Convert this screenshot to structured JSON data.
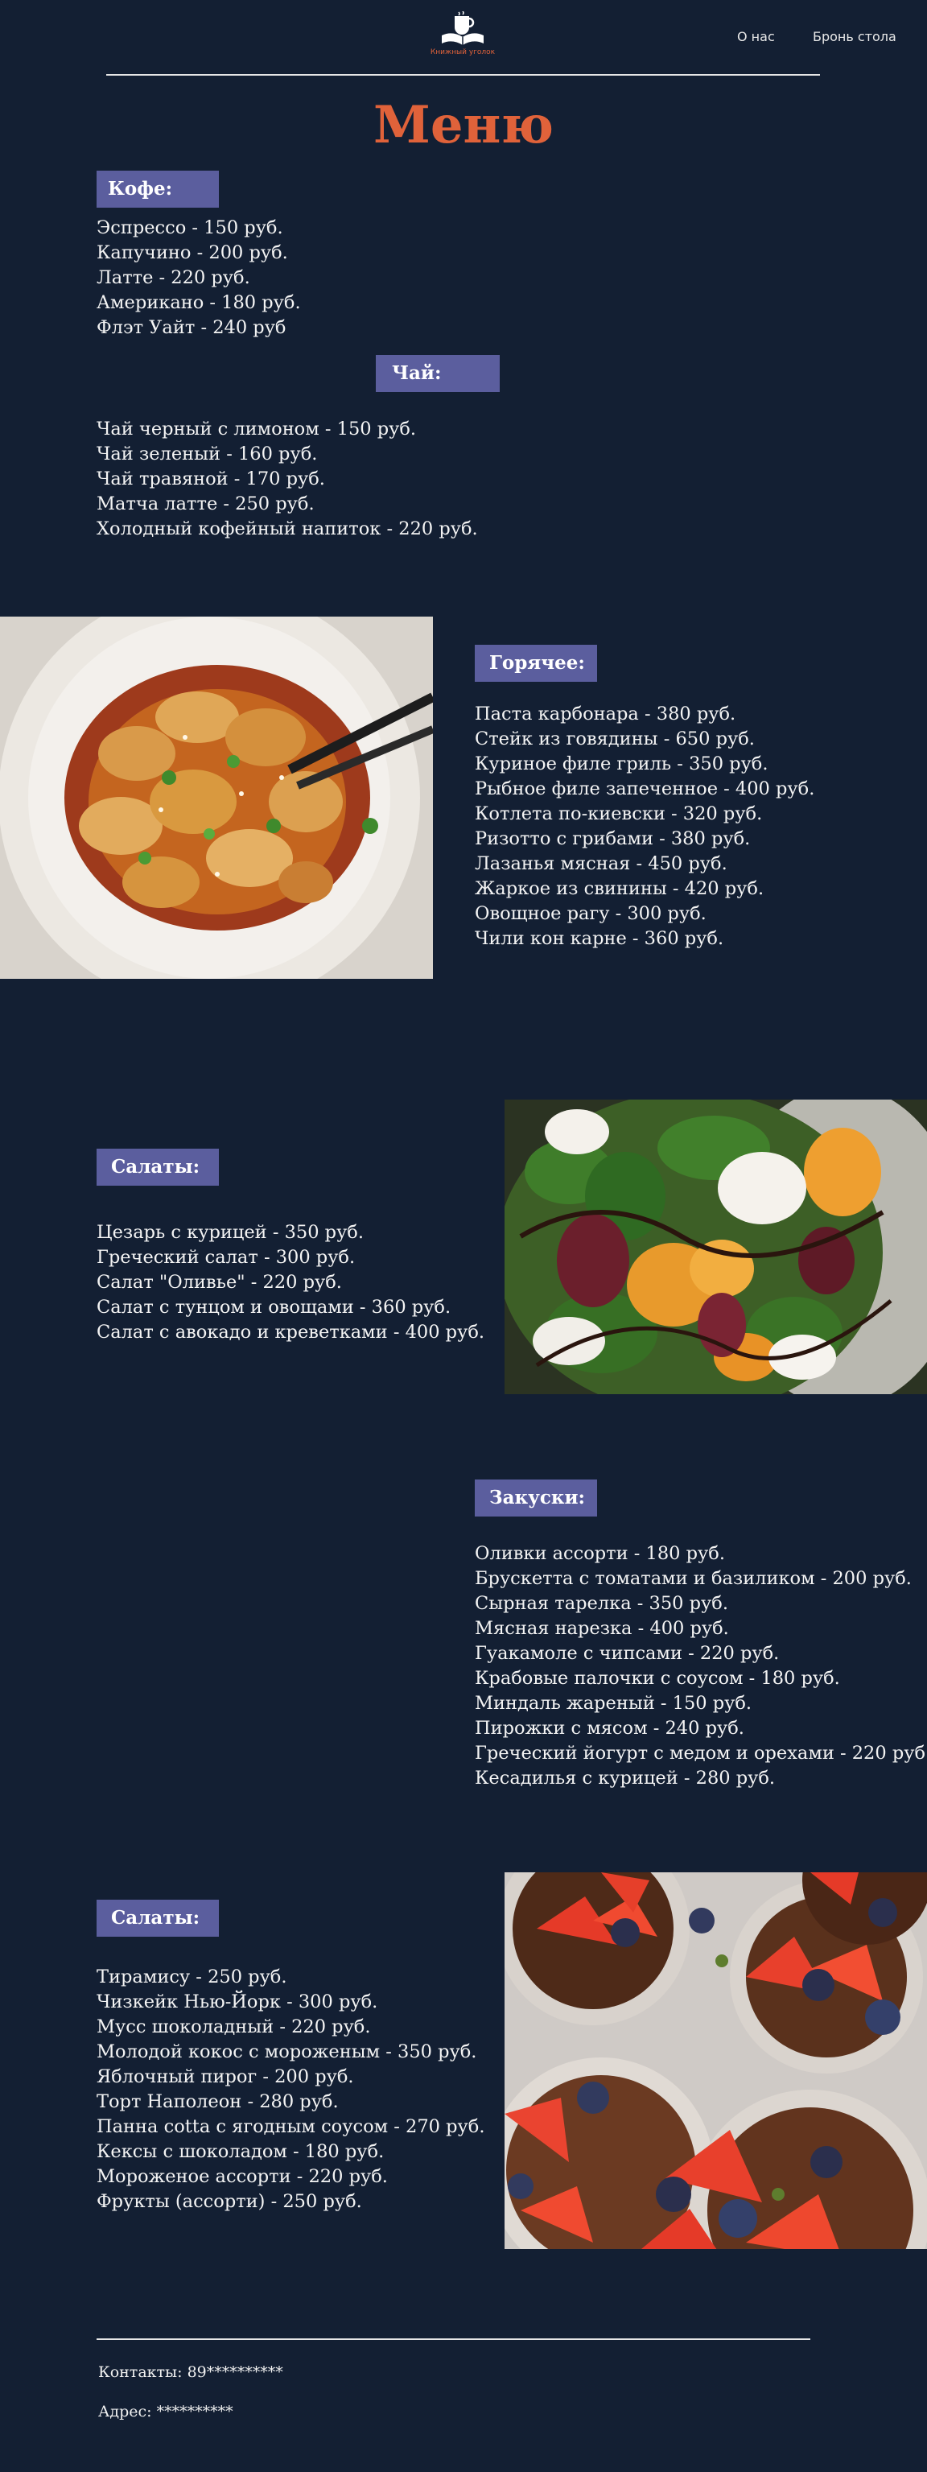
{
  "header": {
    "logo_caption": "Книжный уголок",
    "nav": [
      {
        "label": "О нас"
      },
      {
        "label": "Бронь стола"
      }
    ]
  },
  "page_title": "Меню",
  "sections": {
    "coffee": {
      "title": "Кофе:",
      "items": [
        "Эспрессо - 150 руб.",
        "Капучино - 200 руб.",
        "Латте - 220 руб.",
        "Американо - 180 руб.",
        "Флэт Уайт - 240 руб"
      ]
    },
    "tea": {
      "title": "Чай:",
      "items": [
        "Чай черный с лимоном - 150 руб.",
        "Чай зеленый - 160 руб.",
        "Чай травяной - 170 руб.",
        "Матча латте - 250 руб.",
        "Холодный кофейный напиток - 220 руб."
      ]
    },
    "hot": {
      "title": "Горячее:",
      "items": [
        "Паста карбонара - 380 руб.",
        "Стейк из говядины - 650 руб.",
        "Куриное филе гриль - 350 руб.",
        "Рыбное филе запеченное - 400 руб.",
        "Котлета по-киевски - 320 руб.",
        "Ризотто с грибами - 380 руб.",
        "Лазанья мясная - 450 руб.",
        "Жаркое из свинины - 420 руб.",
        "Овощное рагу - 300 руб.",
        "Чили кон карне - 360 руб."
      ]
    },
    "salads": {
      "title": "Салаты:",
      "items": [
        "Цезарь с курицей - 350 руб.",
        "Греческий салат - 300 руб.",
        "Салат \"Оливье\" - 220 руб.",
        "Салат с тунцом и овощами - 360 руб.",
        "Салат с авокадо и креветками - 400 руб."
      ]
    },
    "snacks": {
      "title": "Закуски:",
      "items": [
        "Оливки ассорти - 180 руб.",
        "Брускетта с томатами и базиликом - 200 руб.",
        "Сырная тарелка - 350 руб.",
        "Мясная нарезка - 400 руб.",
        "Гуакамоле с чипсами - 220 руб.",
        "Крабовые палочки с соусом - 180 руб.",
        "Миндаль жареный - 150 руб.",
        "Пирожки с мясом - 240 руб.",
        "Греческий йогурт с медом и орехами - 220 руб.",
        "Кесадилья с курицей - 280 руб."
      ]
    },
    "desserts": {
      "title": "Салаты:",
      "items": [
        "Тирамису - 250 руб.",
        "Чизкейк Нью-Йорк - 300 руб.",
        "Мусс шоколадный - 220 руб.",
        "Молодой кокос с мороженым - 350 руб.",
        "Яблочный пирог - 200 руб.",
        "Торт Наполеон - 280 руб.",
        "Панна cotta с ягодным соусом - 270 руб.",
        "Кексы с шоколадом - 180 руб.",
        "Мороженое ассорти - 220 руб.",
        "Фрукты (ассорти) - 250 руб."
      ]
    }
  },
  "footer": {
    "contacts": "Контакты: 89**********",
    "address": "Адрес: **********"
  },
  "colors": {
    "background": "#131f33",
    "accent": "#e0623a",
    "badge": "#5b5e9e",
    "text": "#f1f1f1"
  },
  "icons": {
    "logo": "book-with-coffee-cup-icon"
  }
}
